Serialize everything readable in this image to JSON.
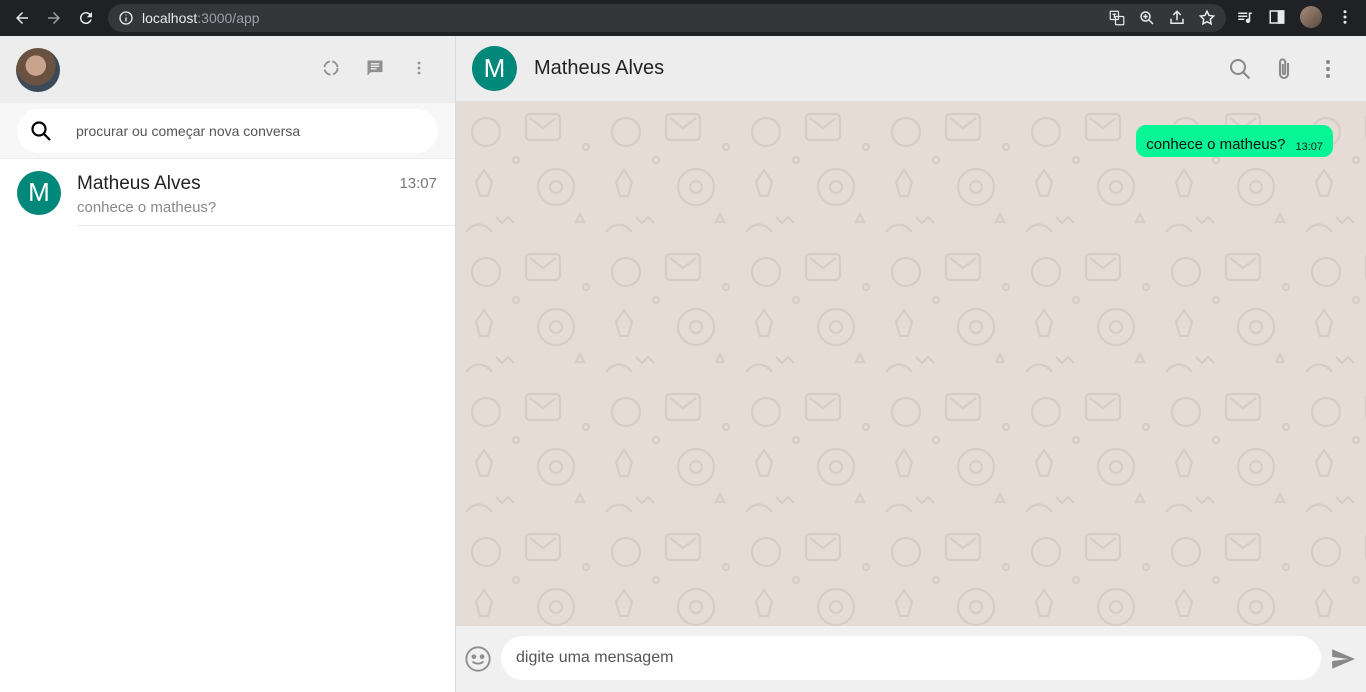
{
  "browser": {
    "url_host": "localhost",
    "url_rest": ":3000/app"
  },
  "sidebar": {
    "search_placeholder": "procurar ou começar nova conversa",
    "chats": [
      {
        "initial": "M",
        "name": "Matheus Alves",
        "time": "13:07",
        "last_message": "conhece o matheus?"
      }
    ]
  },
  "conversation": {
    "initial": "M",
    "contact_name": "Matheus Alves",
    "messages": [
      {
        "text": "conhece o matheus?",
        "time": "13:07",
        "outgoing": true
      }
    ],
    "input_placeholder": "digite uma mensagem"
  },
  "colors": {
    "avatar": "#00887a",
    "outgoing_bubble": "#06f595",
    "wallpaper": "#e4dcd5",
    "header": "#ededed"
  },
  "icons": [
    "back-icon",
    "forward-icon",
    "reload-icon",
    "info-icon",
    "translate-icon",
    "zoom-icon",
    "share-icon",
    "star-icon",
    "media-icon",
    "sidepanel-icon",
    "status-icon",
    "new-chat-icon",
    "menu-icon",
    "search-icon",
    "attach-icon",
    "emoji-icon",
    "send-icon"
  ]
}
